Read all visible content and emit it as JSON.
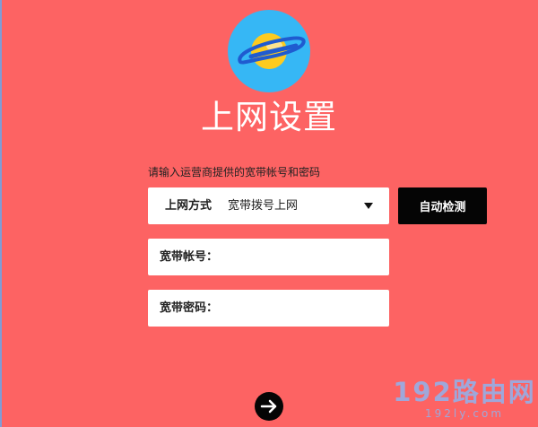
{
  "page": {
    "title": "上网设置",
    "hint": "请输入运营商提供的宽带帐号和密码"
  },
  "form": {
    "method_label": "上网方式",
    "method_value": "宽带拨号上网",
    "detect_label": "自动检测",
    "account_label": "宽带帐号：",
    "account_value": "",
    "password_label": "宽带密码：",
    "password_value": ""
  },
  "icons": {
    "logo": "planet-icon",
    "next": "arrow-right-icon",
    "dropdown": "caret-down-icon"
  },
  "colors": {
    "background": "#fd6363",
    "button": "#050505",
    "logo_circle": "#36b7f5",
    "planet": "#fdcb1f",
    "ring": "#1f5bd0"
  },
  "watermark": {
    "main": "192路由网",
    "sub": "192ly.com"
  }
}
